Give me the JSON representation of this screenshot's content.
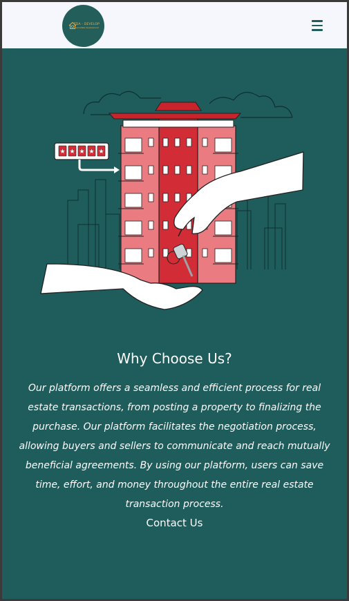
{
  "header": {
    "logo_text": "TDA - DEVELOP",
    "logo_tagline": "real estate development",
    "menu_icon": "hamburger-menu-icon"
  },
  "hero": {
    "illustration": "building-key-handover-illustration",
    "rating_stars": 5
  },
  "content": {
    "title": "Why Choose Us?",
    "description": "Our platform offers a seamless and efficient process for real estate transactions, from posting a property to finalizing the purchase. Our platform facilitates the negotiation process, allowing buyers and sellers to communicate and reach mutually beneficial agreements. By using our platform, users can save time, effort, and money throughout the entire real estate transaction process.",
    "contact_label": "Contact Us"
  },
  "colors": {
    "background": "#1f5c5c",
    "navbar": "#f5f7fc",
    "building": "#e8535c",
    "accent_red": "#c9242c"
  }
}
